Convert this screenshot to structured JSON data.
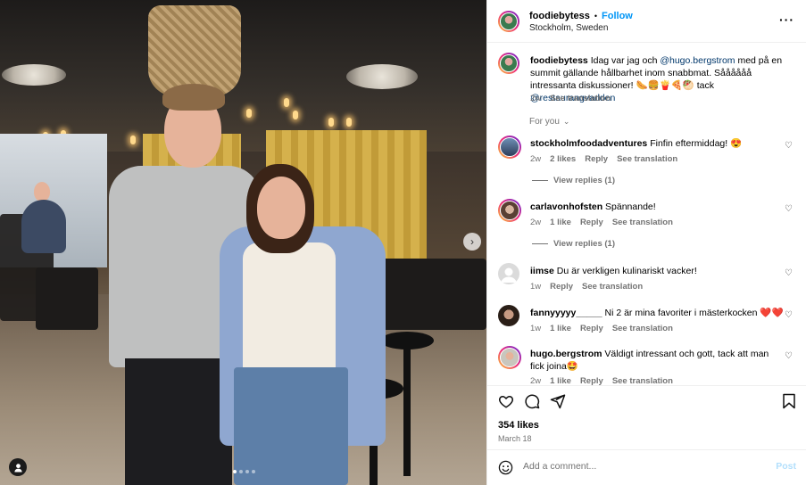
{
  "post": {
    "username": "foodiebytess",
    "separator": "•",
    "follow_label": "Follow",
    "location": "Stockholm, Sweden",
    "more_icon": "more-horizontal-icon",
    "caption": {
      "text_before": "Idag var jag och ",
      "mention_1": "@hugo.bergstrom",
      "text_middle": " med på en summit gällande hållbarhet inom snabbmat. Såååååå intressanta diskussioner! 🌭🍔🍟🍕🥙 tack ",
      "mention_2": "@restaurangvarlden",
      "time": "2w",
      "see_translation": "See translation"
    },
    "for_you_label": "For you"
  },
  "comments": [
    {
      "username": "stockholmfoodadventures",
      "text": "Finfin eftermiddag! 😍",
      "time": "2w",
      "likes": "2 likes",
      "reply": "Reply",
      "see_translation": "See translation",
      "view_replies": "View replies (1)"
    },
    {
      "username": "carlavonhofsten",
      "text": "Spännande!",
      "time": "2w",
      "likes": "1 like",
      "reply": "Reply",
      "see_translation": "See translation",
      "view_replies": "View replies (1)"
    },
    {
      "username": "iimse",
      "text": "Du är verkligen kulinariskt vacker!",
      "time": "1w",
      "likes": "",
      "reply": "Reply",
      "see_translation": "See translation"
    },
    {
      "username": "fannyyyyy_____",
      "text": "Ni 2 är mina favoriter i mästerkocken ❤️❤️",
      "time": "1w",
      "likes": "1 like",
      "reply": "Reply",
      "see_translation": "See translation"
    },
    {
      "username": "hugo.bergstrom",
      "text": "Väldigt intressant och gott, tack att man fick joina🤩",
      "time": "2w",
      "likes": "1 like",
      "reply": "Reply",
      "see_translation": "See translation"
    }
  ],
  "actions": {
    "like_icon": "heart-icon",
    "comment_icon": "comment-icon",
    "share_icon": "send-icon",
    "save_icon": "bookmark-icon",
    "likes_count": "354 likes",
    "date": "March 18"
  },
  "composer": {
    "placeholder": "Add a comment...",
    "post_label": "Post"
  },
  "carousel": {
    "slides": 4,
    "active_slide": 1
  },
  "colors": {
    "follow": "#0095f6",
    "muted": "#737373",
    "mention": "#00376b",
    "post_disabled": "#b2dffc"
  }
}
